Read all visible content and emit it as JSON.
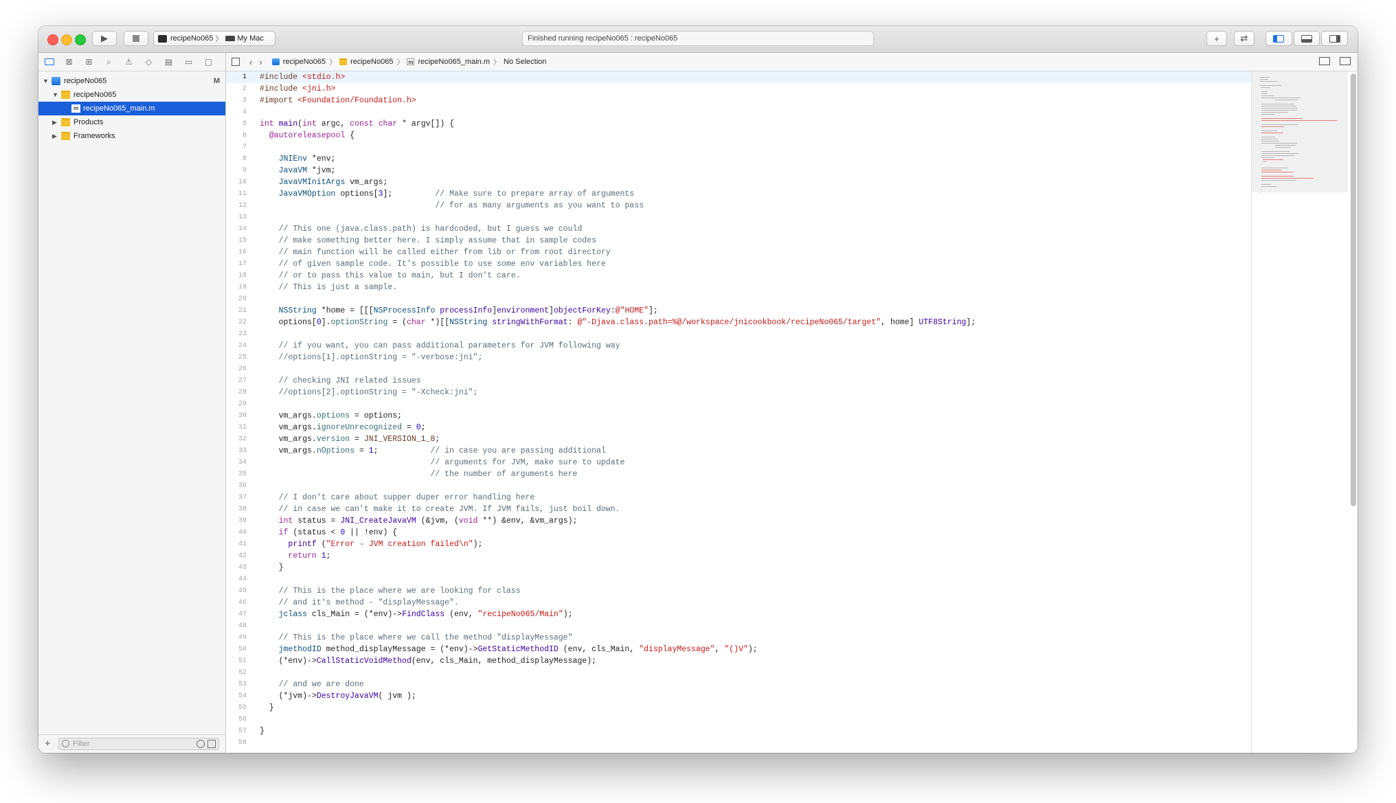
{
  "toolbar": {
    "scheme": "recipeNo065",
    "destination": "My Mac",
    "status": "Finished running recipeNo065 : recipeNo065"
  },
  "navigator": {
    "tree": [
      {
        "label": "recipeNo065",
        "badge": "M",
        "kind": "project"
      },
      {
        "label": "recipeNo065",
        "kind": "folder"
      },
      {
        "label": "recipeNo065_main.m",
        "kind": "file"
      },
      {
        "label": "Products",
        "kind": "folder"
      },
      {
        "label": "Frameworks",
        "kind": "folder"
      }
    ],
    "filter_placeholder": "Filter"
  },
  "jumpbar": {
    "items": [
      "recipeNo065",
      "recipeNo065",
      "recipeNo065_main.m",
      "No Selection"
    ]
  },
  "editor": {
    "current_line": 1,
    "lines": [
      "#include <stdio.h>",
      "#include <jni.h>",
      "#import <Foundation/Foundation.h>",
      "",
      "int main(int argc, const char * argv[]) {",
      "  @autoreleasepool {",
      "",
      "    JNIEnv *env;",
      "    JavaVM *jvm;",
      "    JavaVMInitArgs vm_args;",
      "    JavaVMOption options[3];         // Make sure to prepare array of arguments",
      "                                     // for as many arguments as you want to pass",
      "",
      "    // This one (java.class.path) is hardcoded, but I guess we could",
      "    // make something better here. I simply assume that in sample codes",
      "    // main function will be called either from lib or from root directory",
      "    // of given sample code. It's possible to use some env variables here",
      "    // or to pass this value to main, but I don't care.",
      "    // This is just a sample.",
      "",
      "    NSString *home = [[[NSProcessInfo processInfo]environment]objectForKey:@\"HOME\"];",
      "    options[0].optionString = (char *)[[NSString stringWithFormat: @\"-Djava.class.path=%@/workspace/jnicookbook/recipeNo065/target\", home] UTF8String];",
      "",
      "    // if you want, you can pass additional parameters for JVM following way",
      "    //options[1].optionString = \"-verbose:jni\";",
      "",
      "    // checking JNI related issues",
      "    //options[2].optionString = \"-Xcheck:jni\";",
      "",
      "    vm_args.options = options;",
      "    vm_args.ignoreUnrecognized = 0;",
      "    vm_args.version = JNI_VERSION_1_8;",
      "    vm_args.nOptions = 1;           // in case you are passing additional",
      "                                    // arguments for JVM, make sure to update",
      "                                    // the number of arguments here",
      "",
      "    // I don't care about supper duper error handling here",
      "    // in case we can't make it to create JVM. If JVM fails, just boil down.",
      "    int status = JNI_CreateJavaVM (&jvm, (void **) &env, &vm_args);",
      "    if (status < 0 || !env) {",
      "      printf (\"Error - JVM creation failed\\n\");",
      "      return 1;",
      "    }",
      "",
      "    // This is the place where we are looking for class",
      "    // and it's method - \"displayMessage\".",
      "    jclass cls_Main = (*env)->FindClass (env, \"recipeNo065/Main\");",
      "",
      "    // This is the place where we call the method \"displayMessage\"",
      "    jmethodID method_displayMessage = (*env)->GetStaticMethodID (env, cls_Main, \"displayMessage\", \"()V\");",
      "    (*env)->CallStaticVoidMethod(env, cls_Main, method_displayMessage);",
      "",
      "    // and we are done",
      "    (*jvm)->DestroyJavaVM( jvm );",
      "  }",
      "",
      "}",
      ""
    ]
  },
  "colors": {
    "selection": "#1a5fd9",
    "keyword": "#9b2393",
    "string": "#c41a16",
    "comment": "#5d6c79",
    "number": "#1c00cf"
  }
}
